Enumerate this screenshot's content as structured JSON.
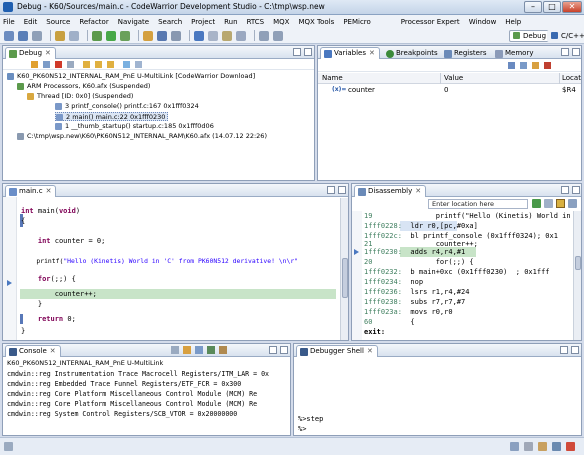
{
  "window": {
    "title": "Debug - K60/Sources/main.c - CodeWarrior Development Studio - C:\\tmp\\wsp.new",
    "min": "–",
    "max": "□",
    "close": "✕"
  },
  "menu": [
    "File",
    "Edit",
    "Source",
    "Refactor",
    "Navigate",
    "Search",
    "Project",
    "Run",
    "RTCS",
    "MQX",
    "MQX Tools",
    "PEMicro",
    "Processor Expert",
    "Window",
    "Help"
  ],
  "perspectives": {
    "debug": "Debug",
    "cc": "C/C++"
  },
  "debug_view": {
    "tab": "Debug",
    "tree": [
      "K60_PK60N512_INTERNAL_RAM_PnE U-MultiLink [CodeWarrior Download]",
      "ARM Processors, K60.afx (Suspended)",
      "Thread [ID: 0x0] (Suspended)",
      "3 printf_console() printf.c:167 0x1fff0324",
      "2 main() main.c:22 0x1fff0230",
      "1 __thumb_startup() startup.c:185 0x1fff0d06",
      "C:\\tmp\\wsp.new\\K60\\PK60N512_INTERNAL_RAM\\K60.afx (14.07.12 22:26)"
    ]
  },
  "vars_view": {
    "tabs": [
      "Variables",
      "Breakpoints",
      "Registers",
      "Memory"
    ],
    "columns": [
      "Name",
      "Value",
      "Locat"
    ],
    "rows": [
      {
        "icon": "(x)=",
        "name": "counter",
        "value": "0",
        "loc": "$R4"
      }
    ]
  },
  "editor": {
    "tab": "main.c",
    "lines": [
      {
        "a": "int",
        "b": " main(",
        "c": "void",
        "d": ")"
      },
      {
        "a": "",
        "b": "{",
        "c": "",
        "d": ""
      },
      {
        "a": "    int",
        "b": " counter = 0;",
        "c": "",
        "d": ""
      },
      {
        "a": "",
        "b": "",
        "c": "",
        "d": ""
      },
      {
        "a": "    printf(",
        "b": "\"Hello (Kinetis) World in 'C' from PK60N512 derivative! \\n\\r\"",
        "c": "",
        "d": ""
      },
      {
        "a": "",
        "b": "",
        "c": "",
        "d": ""
      },
      {
        "a": "    for",
        "b": "(;;) {",
        "c": "",
        "d": ""
      },
      {
        "a": "",
        "b": "        counter++;",
        "c": "",
        "d": ""
      },
      {
        "a": "",
        "b": "    }",
        "c": "",
        "d": ""
      },
      {
        "a": "",
        "b": "",
        "c": "",
        "d": ""
      },
      {
        "a": "    return",
        "b": " 0;",
        "c": "",
        "d": ""
      },
      {
        "a": "",
        "b": "}",
        "c": "",
        "d": ""
      }
    ]
  },
  "disasm": {
    "tab": "Disassembly",
    "location_placeholder": "Enter location here",
    "lines": [
      {
        "addr": "19",
        "code": "        printf(\"Hello (Kinetis) World in '"
      },
      {
        "addr": "1fff0228:",
        "code": "  ldr r0,[pc,#0xa]"
      },
      {
        "addr": "1fff022c:",
        "code": "  bl printf_console (0x1fff0324); 0x1"
      },
      {
        "addr": "21",
        "code": "        counter++;"
      },
      {
        "addr": "1fff0230:",
        "code": "  adds r4,r4,#1"
      },
      {
        "addr": "20",
        "code": "        for(;;) {"
      },
      {
        "addr": "1fff0232:",
        "code": "  b main+0xc (0x1fff0230)  ; 0x1fff"
      },
      {
        "addr": "1fff0234:",
        "code": "  nop"
      },
      {
        "addr": "1fff0236:",
        "code": "  lsrs r1,r4,#24"
      },
      {
        "addr": "1fff0238:",
        "code": "  subs r7,r7,#7"
      },
      {
        "addr": "1fff023a:",
        "code": "  movs r0,r0"
      },
      {
        "addr": "60",
        "code": "  {"
      },
      {
        "addr": "",
        "code": "exit:"
      }
    ]
  },
  "console": {
    "tab": "Console",
    "header": "K60_PK60N512_INTERNAL_RAM_PnE U-MultiLink",
    "lines": [
      "cmdwin::reg Instrumentation Trace Macrocell Registers/ITM_LAR = 0x",
      "cmdwin::reg Embedded Trace Funnel Registers/ETF_FCR = 0x300",
      "cmdwin::reg Core Platform Miscellaneous Control Module (MCM) Re",
      "cmdwin::reg Core Platform Miscellaneous Control Module (MCM) Re",
      "cmdwin::reg System Control Registers/SCB_VTOR = 0x20000000"
    ]
  },
  "shell": {
    "tab": "Debugger Shell",
    "lines": [
      "%>step",
      "%>"
    ]
  }
}
